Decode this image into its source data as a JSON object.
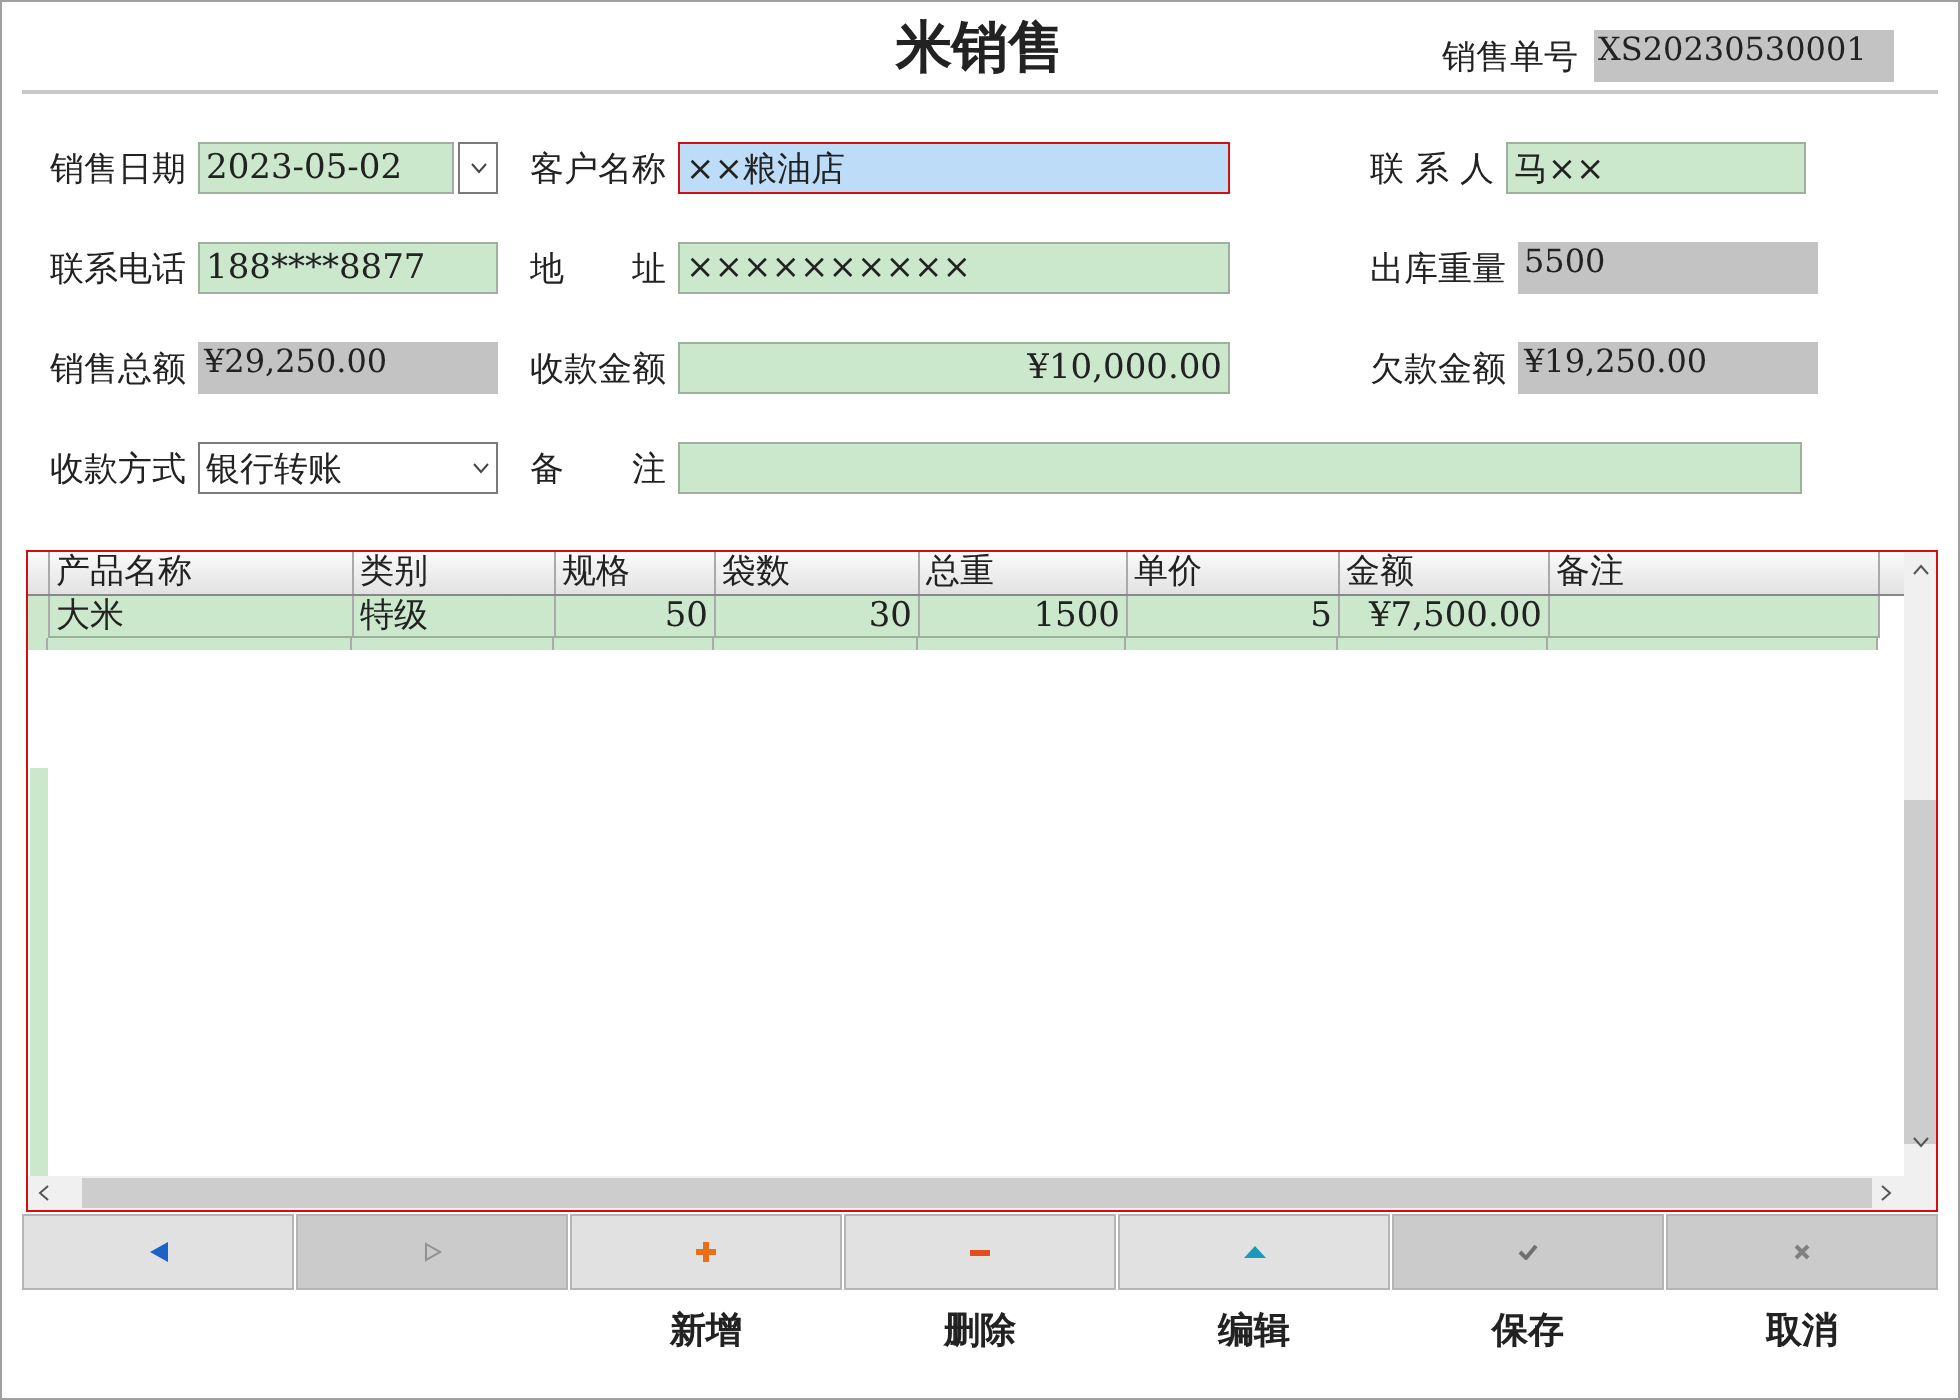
{
  "window": {
    "title": "米销售"
  },
  "order_no": {
    "label": "销售单号",
    "value": "XS20230530001"
  },
  "fields": [
    {
      "label": "销售日期",
      "value": "2023-05-02",
      "kind": "date"
    },
    {
      "label": "客户名称",
      "value": "××粮油店",
      "kind": "text",
      "focused": true
    },
    {
      "label": "联 系 人",
      "value": "马××",
      "kind": "text"
    },
    {
      "label": "联系电话",
      "value": "188****8877",
      "kind": "text"
    },
    {
      "label": "地　　址",
      "value": "××××××××××",
      "kind": "text"
    },
    {
      "label": "出库重量",
      "value": "5500",
      "kind": "readonly"
    },
    {
      "label": "销售总额",
      "value": "¥29,250.00",
      "kind": "readonly"
    },
    {
      "label": "收款金额",
      "value": "¥10,000.00",
      "kind": "amount"
    },
    {
      "label": "欠款金额",
      "value": "¥19,250.00",
      "kind": "readonly"
    },
    {
      "label": "收款方式",
      "value": "银行转账",
      "kind": "combo"
    },
    {
      "label": "备　　注",
      "kind": "text",
      "wide": true
    }
  ],
  "table": {
    "columns": [
      {
        "label": "产品名称",
        "kind": "text"
      },
      {
        "label": "类别",
        "kind": "text"
      },
      {
        "label": "规格",
        "kind": "number"
      },
      {
        "label": "袋数",
        "kind": "number"
      },
      {
        "label": "总重",
        "kind": "number"
      },
      {
        "label": "单价",
        "kind": "number"
      },
      {
        "label": "金额",
        "kind": "number"
      },
      {
        "label": "备注",
        "kind": "text"
      }
    ],
    "rows": [
      {
        "cells": [
          "大米",
          "特级",
          "50",
          "30",
          "1500",
          "5",
          "¥7,500.00",
          ""
        ]
      }
    ]
  },
  "buttons": [
    {
      "kind": "prev",
      "disabled": false
    },
    {
      "kind": "next",
      "disabled": true
    },
    {
      "kind": "add",
      "disabled": false,
      "label": "新增"
    },
    {
      "kind": "delete",
      "disabled": false,
      "label": "删除"
    },
    {
      "kind": "edit",
      "disabled": false,
      "label": "编辑"
    },
    {
      "kind": "save",
      "disabled": true,
      "label": "保存"
    },
    {
      "kind": "cancel",
      "disabled": true,
      "label": "取消"
    }
  ]
}
